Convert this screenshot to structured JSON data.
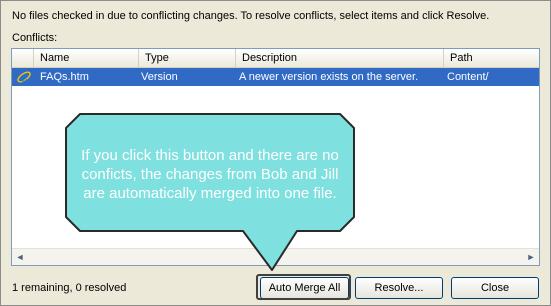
{
  "message": "No files checked in due to conflicting changes.  To resolve conflicts, select items and click Resolve.",
  "conflicts_label": "Conflicts:",
  "columns": [
    "Name",
    "Type",
    "Description",
    "Path"
  ],
  "rows": [
    {
      "name": "FAQs.htm",
      "type": "Version",
      "description": "A newer version exists on the server.",
      "path": "Content/",
      "icon": "ie-file-icon"
    }
  ],
  "status": "1 remaining, 0 resolved",
  "buttons": {
    "auto_merge": "Auto Merge All",
    "resolve": "Resolve...",
    "close": "Close"
  },
  "callout": {
    "text": "If you click this button and there are no conficts, the changes from Bob and Jill are automatically merged into one file.",
    "fill": "#7fe0e0",
    "stroke": "#2a2a2a"
  },
  "colors": {
    "selection": "#316ac5",
    "dialog_bg": "#ece9d8"
  }
}
